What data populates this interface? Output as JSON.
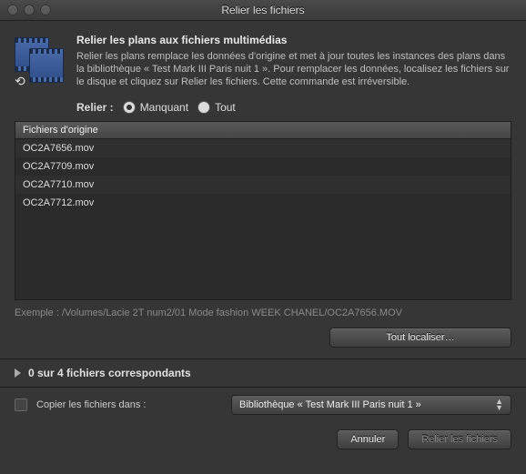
{
  "window": {
    "title": "Relier les fichiers"
  },
  "header": {
    "title": "Relier les plans aux fichiers multimédias",
    "body": "Relier les plans remplace les données d'origine et met à jour toutes les instances des plans dans la bibliothèque « Test Mark III Paris nuit 1 ». Pour remplacer les données, localisez les fichiers sur le disque et cliquez sur Relier les fichiers. Cette commande est irréversible."
  },
  "relink": {
    "label": "Relier :",
    "missing": "Manquant",
    "all": "Tout",
    "selected": "missing"
  },
  "table": {
    "header": "Fichiers d'origine",
    "rows": [
      "OC2A7656.mov",
      "OC2A7709.mov",
      "OC2A7710.mov",
      "OC2A7712.mov"
    ]
  },
  "example": {
    "label": "Exemple :",
    "path": "/Volumes/Lacie 2T num2/01 Mode fashion WEEK CHANEL/OC2A7656.MOV"
  },
  "locate_all": "Tout localiser…",
  "matching": "0 sur 4 fichiers correspondants",
  "copy": {
    "label": "Copier les fichiers dans :",
    "destination": "Bibliothèque « Test Mark III Paris nuit 1 »"
  },
  "buttons": {
    "cancel": "Annuler",
    "relink": "Relier les fichiers"
  }
}
